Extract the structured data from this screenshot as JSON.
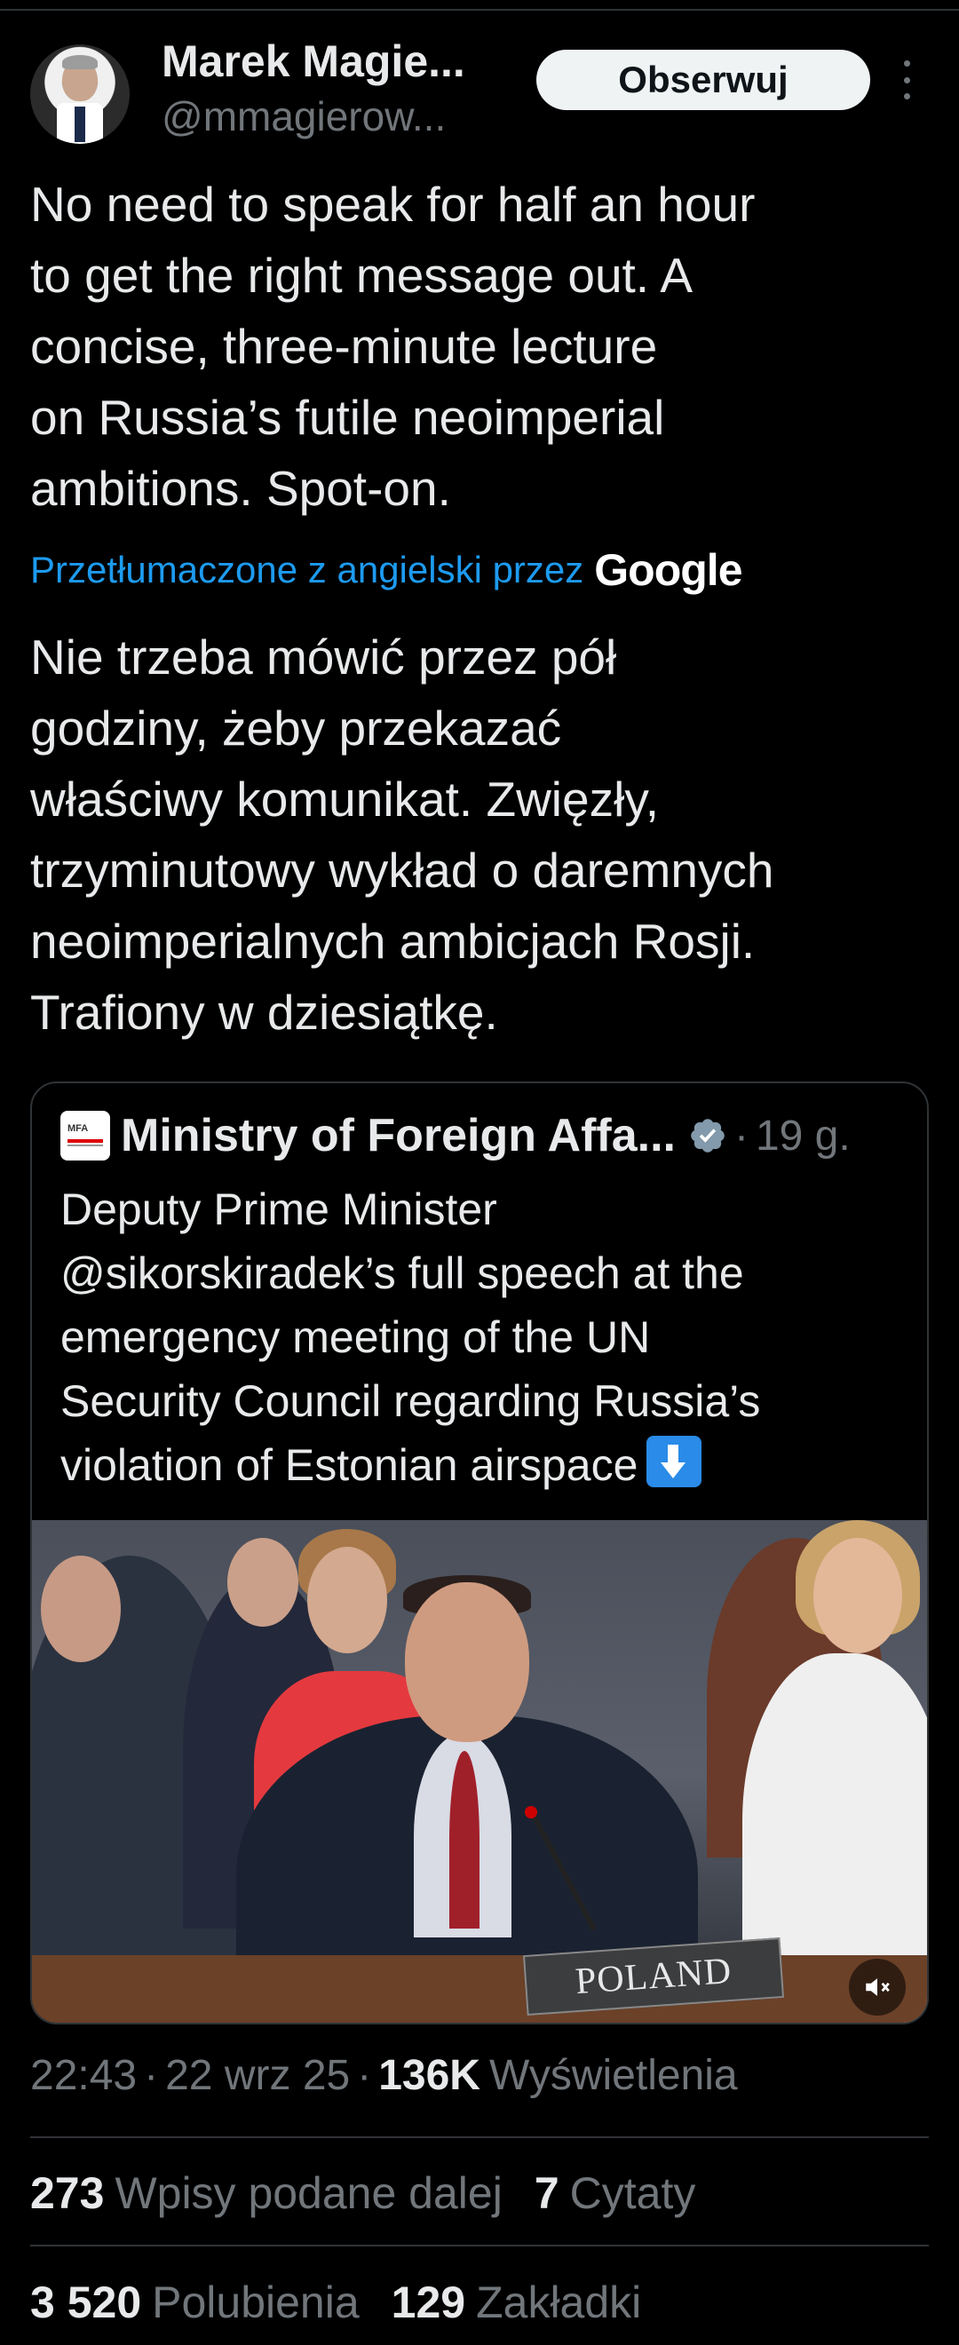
{
  "header": {
    "name": "Marek Magie...",
    "handle": "@mmagierow...",
    "follow_label": "Obserwuj",
    "more_icon": "more-vertical-icon"
  },
  "tweet": {
    "text": "No need to speak for half an hour\nto get the right message out. A\nconcise, three-minute lecture\non Russia’s futile neoimperial\nambitions. Spot-on.",
    "translated_label": "Przetłumaczone z angielski przez",
    "translator": "Google",
    "translation": "Nie trzeba mówić przez pół\ngodziny, żeby przekazać\nwłaściwy komunikat. Zwięzły,\ntrzyminutowy wykład o daremnych\nneoimperialnych ambicjach Rosji.\nTrafiony w dziesiątkę."
  },
  "quote": {
    "logo_text": "MFA",
    "name": "Ministry of Foreign Affa...",
    "separator": "·",
    "time": "19 g.",
    "text": "Deputy Prime Minister\n@sikorskiradek’s full speech at the\nemergency meeting of the UN\nSecurity Council regarding Russia’s\nviolation of Estonian airspace",
    "nameplate": "POLAND",
    "verified_color": "#829aab"
  },
  "meta": {
    "time": "22:43",
    "sep": "·",
    "date": "22 wrz 25",
    "views_count": "136K",
    "views_label": "Wyświetlenia"
  },
  "stats": {
    "reposts_count": "273",
    "reposts_label": "Wpisy podane dalej",
    "quotes_count": "7",
    "quotes_label": "Cytaty",
    "likes_count": "3 520",
    "likes_label": "Polubienia",
    "bookmarks_count": "129",
    "bookmarks_label": "Zakładki"
  },
  "colors": {
    "background": "#000000",
    "text": "#e7e9ea",
    "muted": "#71767b",
    "link": "#1d9bf0",
    "divider": "#2f3336"
  }
}
